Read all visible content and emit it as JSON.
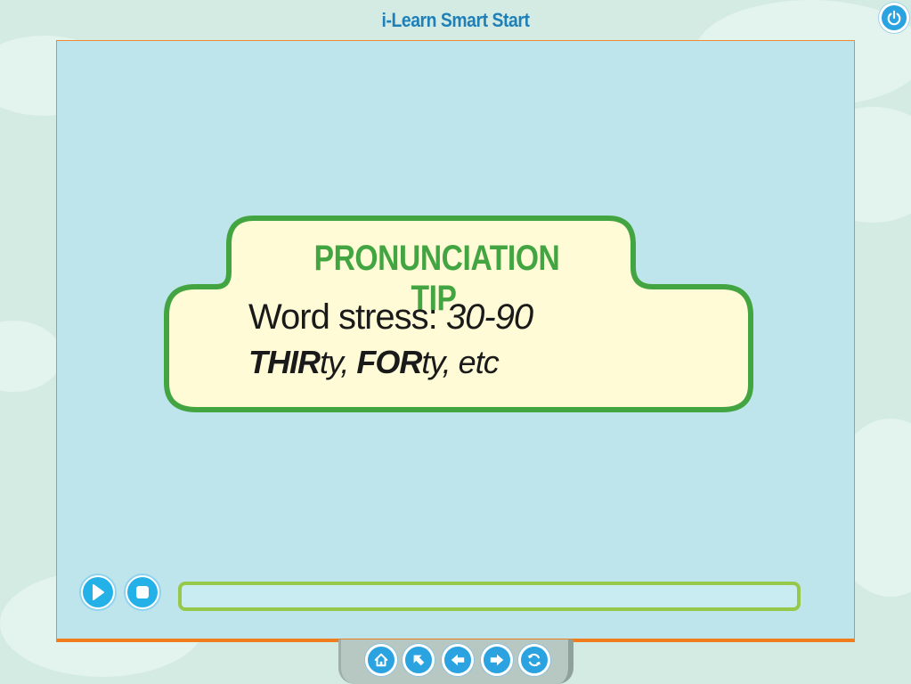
{
  "app": {
    "title": "i-Learn Smart Start"
  },
  "tip": {
    "heading": "PRONUNCIATION TIP",
    "line1_prefix": "Word stress: ",
    "line1_range": "30-90",
    "line2_stress1": "THIR",
    "line2_rest1": "ty, ",
    "line2_stress2": "FOR",
    "line2_rest2": "ty, etc"
  },
  "player": {
    "play_icon": "play-icon",
    "stop_icon": "stop-icon",
    "progress": 0
  },
  "nav": {
    "icons": [
      "home-icon",
      "arrow-up-left-icon",
      "arrow-left-icon",
      "arrow-right-icon",
      "refresh-icon"
    ]
  },
  "colors": {
    "stage_background": "#bfe5ec",
    "card_fill": "#fefbd6",
    "card_border": "#43a542",
    "heading": "#43a542",
    "button_blue": "#2aa3e0",
    "progress_border": "#96c94a",
    "stage_border": "#ef7d1c"
  }
}
